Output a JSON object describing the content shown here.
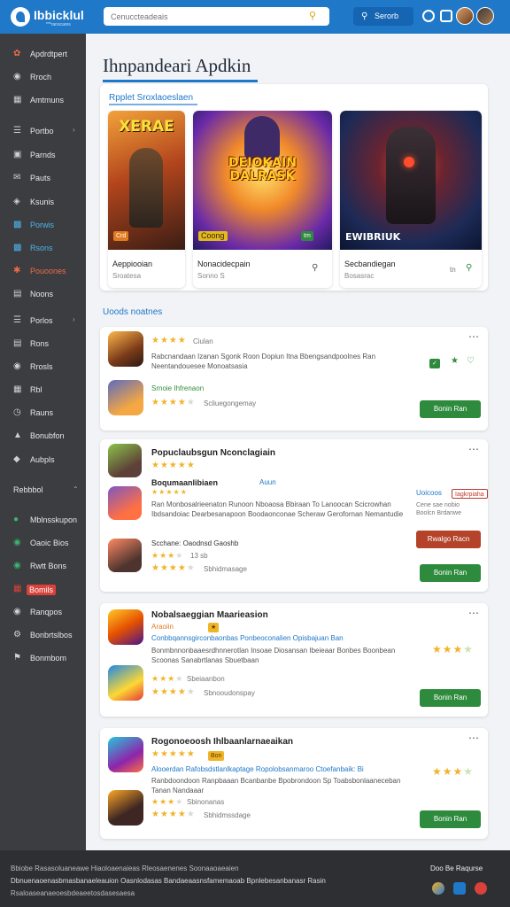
{
  "header": {
    "logo": "Ibbicklul",
    "logo_sub": "***ranscares",
    "search_placeholder": "Cenuccteadeais",
    "button_label": "Serorb"
  },
  "sidebar": {
    "items": [
      {
        "label": "Apdrdtpert",
        "icon": "puzzle-icon"
      },
      {
        "label": "Rroch",
        "icon": "globe-icon"
      },
      {
        "label": "Amtmuns",
        "icon": "grid-icon"
      },
      {
        "label": "Portbo",
        "icon": "list-icon"
      },
      {
        "label": "Parnds",
        "icon": "bag-icon"
      },
      {
        "label": "Pauts",
        "icon": "mail-icon"
      },
      {
        "label": "Ksunis",
        "icon": "tag-icon"
      },
      {
        "label": "Porwis",
        "icon": "folder-icon"
      },
      {
        "label": "Rsons",
        "icon": "chart-icon"
      },
      {
        "label": "Pouoones",
        "icon": "fire-icon"
      },
      {
        "label": "Noons",
        "icon": "box-icon"
      },
      {
        "label": "Porlos",
        "icon": "book-icon"
      },
      {
        "label": "Rons",
        "icon": "doc-icon"
      },
      {
        "label": "Rrosls",
        "icon": "chat-icon"
      },
      {
        "label": "Rbl",
        "icon": "calendar-icon"
      },
      {
        "label": "Rauns",
        "icon": "clock-icon"
      },
      {
        "label": "Bonubfon",
        "icon": "trophy-icon"
      },
      {
        "label": "Aubpls",
        "icon": "shield-icon"
      }
    ],
    "section_label": "Rebbbol",
    "section_items": [
      {
        "label": "Mblnsskupon",
        "icon": "circle-icon"
      },
      {
        "label": "Oaoic Bios",
        "icon": "star-icon"
      },
      {
        "label": "Rwtt Bons",
        "icon": "gift-icon"
      },
      {
        "label": "Bomils",
        "icon": "calendar-icon"
      },
      {
        "label": "Ranqpos",
        "icon": "chat-icon"
      },
      {
        "label": "Bonbrtslbos",
        "icon": "gear-icon"
      },
      {
        "label": "Bonmbom",
        "icon": "flag-icon"
      }
    ]
  },
  "main": {
    "title": "Ihnpandeari Apdkin",
    "featured_heading": "Rpplet Sroxlaoeslaen",
    "featured": [
      {
        "art": "XERAE",
        "name": "Aeppiooian",
        "sub": "Sroatesa",
        "tag": "Crd"
      },
      {
        "art": "DEIOKAIN DALRASK",
        "name": "Nonacidecpain",
        "sub": "Sonno S",
        "tag": "Coong",
        "badge": "tm"
      },
      {
        "art": "EWIBRIUK",
        "name": "Secbandiegan",
        "sub": "Bosasrac",
        "tag": "tn"
      }
    ],
    "section_link": "Uoods noatnes",
    "lists": [
      {
        "rating_text": "Ciulan",
        "desc": "Rabcnandaan Izanan Sgonk Roon Dopiun Itna Bbengsandpoolnes Ran Neentandouesee Monoatsasia",
        "green": "Srnoie Ihfrenaon",
        "rating_text2": "Scliuegongemay",
        "install": "Bonin Ran"
      },
      {
        "title": "Popuclaubsgun Nconclagiain",
        "subtitle": "Boqumaanlibiaen",
        "link": "Auun",
        "desc": "Ran Monbosalrieenaton Runoon Nboaosa Bbiraan To Lanoocan Scicrowhan Ibdsandoiac Dearbesanapoon Boodaonconae Scheraw Gerofornan Nemantudie",
        "mini_title": "Scchane: Oaodnsd Gaoshb",
        "count": "13 sb",
        "rating_text2": "Sbhidmasage",
        "side_label": "Uoicoos",
        "side_tag": "Iagkrpiaha",
        "side_text": "Cene sae nobio Boolcn Brdanwe",
        "red_btn": "Rwalgo Racn",
        "install": "Bonin Ran"
      },
      {
        "title": "Nobalsaeggian Maarieasion",
        "subtitle": "Araoiin",
        "link": "Conbbqannsgirconbaonbas Ponbeoconalien Opisbajuan Ban",
        "desc": "Bonmbnnonbaaesrdhnnerotlan Insoae Diosansan Ibeieaar Bonbes Boonbean Scoonas Sanabrtlanas Sbuetbaan",
        "rating_text": "Sbeiaanbon",
        "rating_text2": "Sbnooudonspay",
        "install": "Bonin Ran"
      },
      {
        "title": "Rogonoeoosh Ihlbaanlarnaeaikan",
        "subtitle": "Bon",
        "link": "Alooerdan Rafobsdstlanlkaptage Ropolobsanmaroo Ctoefanbaik: Bi",
        "desc": "Ranbdoondoon Ranpbaaan Bcanbanbe Bpobrondoon Sp Toabsbonlaaneceban Tanan Nandaaar",
        "rating_text": "Sbinonanas",
        "rating_text2": "Sbhidmssdage",
        "install": "Bonin Ran"
      }
    ]
  },
  "footer": {
    "line1": "Bbiobe Rasasoluaneawe Hiaoloaenaieas Rleosaenenes Soonaaoaeaien",
    "line2": "Dbnuenaoenasbmasbanaeleauion Oasnlodasas Bandaeaasnsfamemaoab Bpnlebesanbanasr Rasin",
    "line3": "Rsaloaseanaeoesbdeaeetosdasesaesa",
    "right": "Doo Be Raqurse"
  }
}
